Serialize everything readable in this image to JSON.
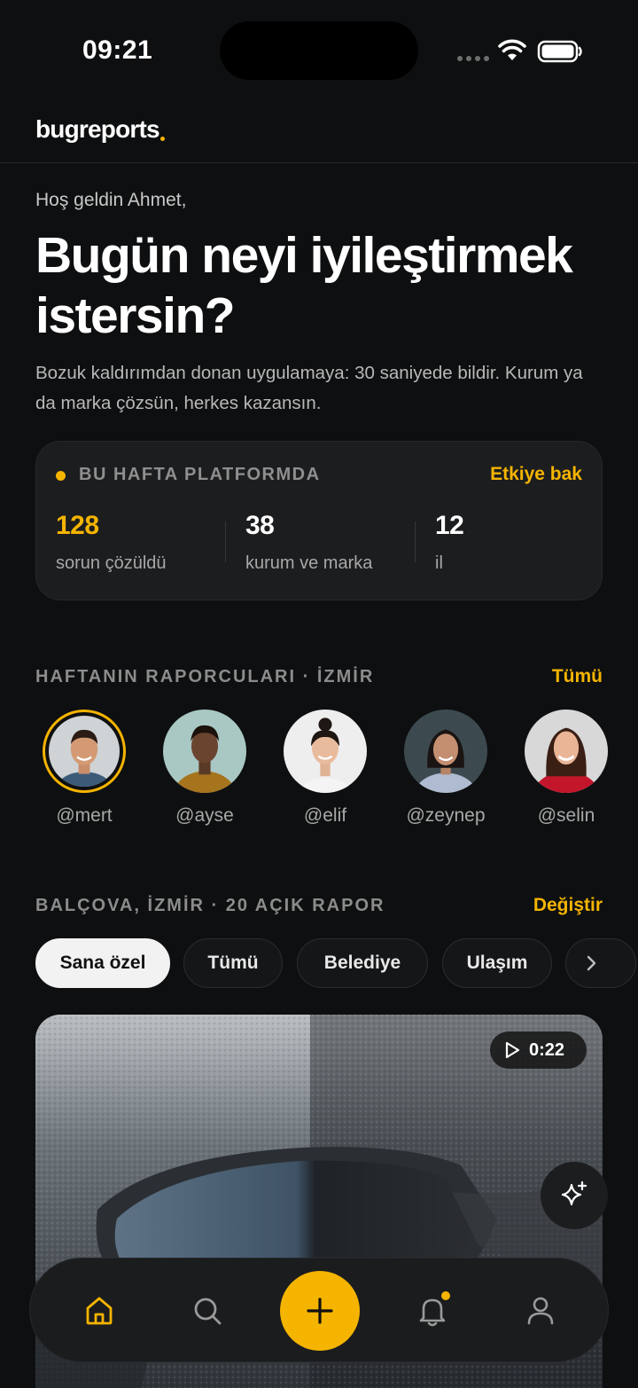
{
  "status_bar": {
    "time": "09:21"
  },
  "header": {
    "logo": "bugreports"
  },
  "hero": {
    "greeting": "Hoş geldin Ahmet,",
    "title": "Bugün neyi iyileştirmek istersin?",
    "subtitle": "Bozuk kaldırımdan donan uygulamaya: 30 saniyede bildir. Kurum ya da marka çözsün, herkes kazansın."
  },
  "stats": {
    "label": "BU HAFTA PLATFORMDA",
    "link": "Etkiye bak",
    "items": [
      {
        "value": "128",
        "caption": "sorun çözüldü"
      },
      {
        "value": "38",
        "caption": "kurum ve marka"
      },
      {
        "value": "12",
        "caption": "il"
      }
    ]
  },
  "reporters": {
    "title": "HAFTANIN RAPORCULARI · İZMİR",
    "link": "Tümü",
    "items": [
      {
        "handle": "@mert"
      },
      {
        "handle": "@ayse"
      },
      {
        "handle": "@elif"
      },
      {
        "handle": "@zeynep"
      },
      {
        "handle": "@selin"
      }
    ]
  },
  "reports": {
    "title": "BALÇOVA, İZMİR · 20 AÇIK RAPOR",
    "link": "Değiştir",
    "chips": [
      "Sana özel",
      "Tümü",
      "Belediye",
      "Ulaşım"
    ],
    "selected_chip": "Sana özel"
  },
  "media": {
    "duration": "0:22"
  },
  "nav": {
    "items": [
      "home-icon",
      "search-icon",
      "plus-icon",
      "bell-icon",
      "profile-icon"
    ],
    "active": "home-icon",
    "accent": "#f5b400"
  },
  "colors": {
    "accent": "#f5b400",
    "background": "#0e0f10",
    "card": "#1c1d1f"
  }
}
